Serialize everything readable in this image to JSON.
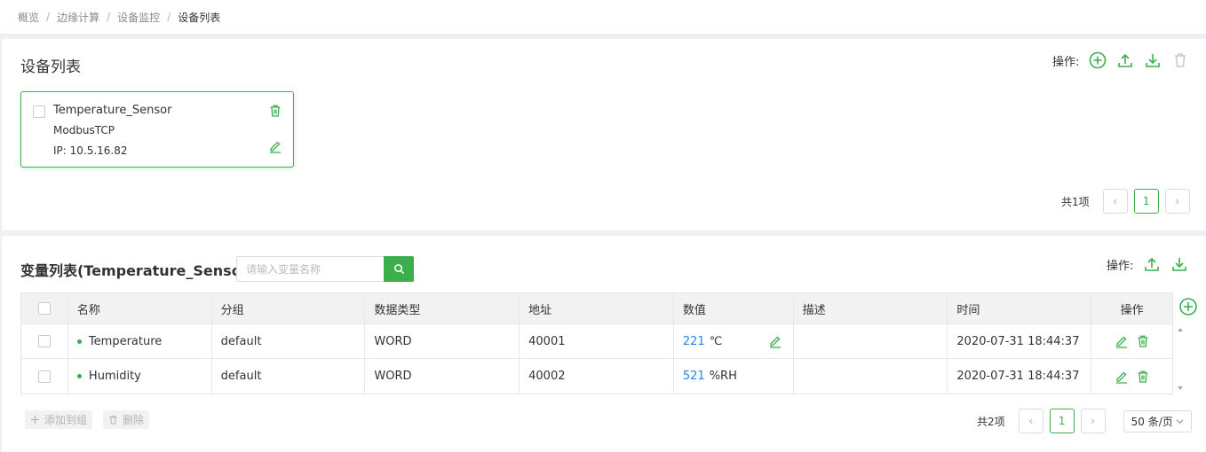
{
  "breadcrumb": {
    "items": [
      "概览",
      "边缘计算",
      "设备监控"
    ],
    "current": "设备列表",
    "separator": "/"
  },
  "device_panel": {
    "title": "设备列表",
    "ops_label": "操作:",
    "devices": [
      {
        "name": "Temperature_Sensor",
        "protocol": "ModbusTCP",
        "ip": "IP: 10.5.16.82"
      }
    ],
    "pager": {
      "total": "共1项",
      "current_page": "1",
      "prev": "‹",
      "next": "›"
    }
  },
  "variable_panel": {
    "title": "变量列表(Temperature_Sensor)",
    "ops_label": "操作:",
    "search": {
      "placeholder": "请输入变量名称",
      "value": ""
    },
    "columns": [
      "名称",
      "分组",
      "数据类型",
      "地址",
      "数值",
      "描述",
      "时间",
      "操作"
    ],
    "rows": [
      {
        "name": "Temperature",
        "group": "default",
        "type": "WORD",
        "address": "40001",
        "value": "221",
        "unit": "℃",
        "desc": "",
        "time": "2020-07-31 18:44:37"
      },
      {
        "name": "Humidity",
        "group": "default",
        "type": "WORD",
        "address": "40002",
        "value": "521",
        "unit": "%RH",
        "desc": "",
        "time": "2020-07-31 18:44:37"
      }
    ],
    "add_to_group_label": "添加到组",
    "delete_label": "删除",
    "pager": {
      "total": "共2项",
      "current_page": "1",
      "prev": "‹",
      "next": "›",
      "page_size": "50 条/页"
    }
  },
  "colors": {
    "accent": "#3cae4c",
    "value_blue": "#1e88e5",
    "disabled": "#b3b3b3"
  }
}
